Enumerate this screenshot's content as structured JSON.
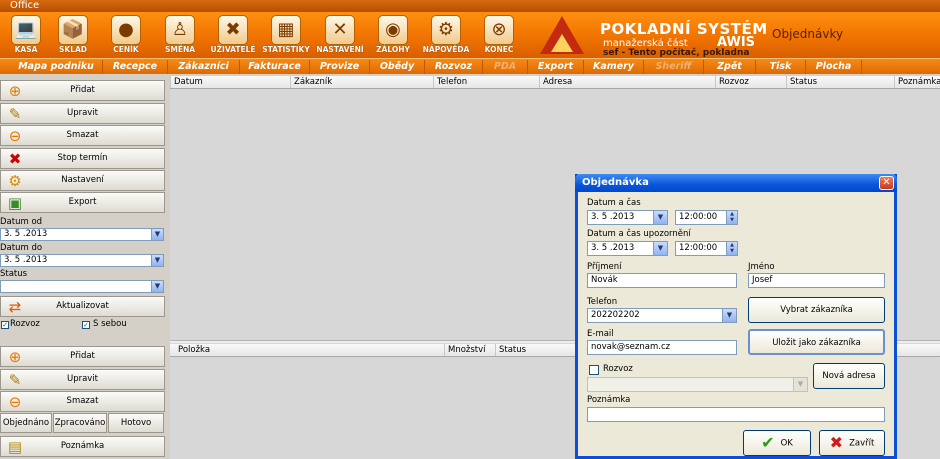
{
  "window": {
    "title": "Office"
  },
  "toolbar": {
    "tools": [
      {
        "label": "KASA",
        "icon": "cash-register-icon",
        "glyph": "💻"
      },
      {
        "label": "SKLAD",
        "icon": "warehouse-icon",
        "glyph": "📦"
      },
      {
        "label": "CENÍK",
        "icon": "price-list-icon",
        "glyph": "●"
      },
      {
        "label": "SMĚNA",
        "icon": "shift-icon",
        "glyph": "♙"
      },
      {
        "label": "UŽIVATELÉ",
        "icon": "users-icon",
        "glyph": "✖"
      },
      {
        "label": "STATISTIKY",
        "icon": "statistics-icon",
        "glyph": "▦"
      },
      {
        "label": "NASTAVENÍ",
        "icon": "settings-tools-icon",
        "glyph": "✕"
      },
      {
        "label": "ZÁLOHY",
        "icon": "backup-disc-icon",
        "glyph": "◉"
      },
      {
        "label": "NÁPOVĚDA",
        "icon": "help-icon",
        "glyph": "⚙"
      },
      {
        "label": "KONEC",
        "icon": "exit-icon",
        "glyph": "⊗"
      }
    ],
    "brand": {
      "title": "POKLADNÍ SYSTÉM",
      "subtitle": "manažerská část",
      "product": "AWIS",
      "section": "Objednávky",
      "user_line": "sef  -  Tento počítač, pokladna"
    }
  },
  "menu": [
    {
      "label": "Mapa podniku",
      "enabled": true
    },
    {
      "label": "Recepce",
      "enabled": true
    },
    {
      "label": "Zákazníci",
      "enabled": true
    },
    {
      "label": "Fakturace",
      "enabled": true
    },
    {
      "label": "Provize",
      "enabled": true
    },
    {
      "label": "Obědy",
      "enabled": true
    },
    {
      "label": "Rozvoz",
      "enabled": true
    },
    {
      "label": "PDA",
      "enabled": false
    },
    {
      "label": "Export",
      "enabled": true
    },
    {
      "label": "Kamery",
      "enabled": true
    },
    {
      "label": "Sheriff",
      "enabled": false
    },
    {
      "label": "Zpět",
      "enabled": true
    },
    {
      "label": "Tisk",
      "enabled": true
    },
    {
      "label": "Plocha",
      "enabled": true
    }
  ],
  "left": {
    "orders_buttons": [
      {
        "label": "Přidat",
        "icon": "add-icon"
      },
      {
        "label": "Upravit",
        "icon": "edit-pencil-icon"
      },
      {
        "label": "Smazat",
        "icon": "remove-icon"
      },
      {
        "label": "Stop termín",
        "icon": "stop-cross-icon"
      },
      {
        "label": "Nastavení",
        "icon": "settings-gear-icon"
      },
      {
        "label": "Export",
        "icon": "export-icon"
      }
    ],
    "date_from_label": "Datum od",
    "date_from_value": "3. 5 .2013",
    "date_to_label": "Datum do",
    "date_to_value": "3. 5 .2013",
    "status_label": "Status",
    "status_value": "",
    "refresh_label": "Aktualizovat",
    "check_delivery_label": "Rozvoz",
    "check_takeaway_label": "S sebou",
    "items_buttons": [
      {
        "label": "Přidat",
        "icon": "add-icon"
      },
      {
        "label": "Upravit",
        "icon": "edit-pencil-icon"
      },
      {
        "label": "Smazat",
        "icon": "remove-icon"
      }
    ],
    "state_buttons": [
      "Objednáno",
      "Zpracováno",
      "Hotovo"
    ],
    "note_label": "Poznámka"
  },
  "orders_grid": {
    "columns": [
      "Datum",
      "Zákazník",
      "Telefon",
      "Adresa",
      "Rozvoz",
      "Status",
      "Poznámka"
    ]
  },
  "items_grid": {
    "columns": [
      "Položka",
      "Množství",
      "Status"
    ]
  },
  "dialog": {
    "title": "Objednávka",
    "datetime_label": "Datum a čas",
    "date_value": "3. 5 .2013",
    "time_value": "12:00:00",
    "reminder_label": "Datum a čas upozornění",
    "reminder_date_value": "3. 5 .2013",
    "reminder_time_value": "12:00:00",
    "surname_label": "Příjmení",
    "surname_value": "Novák",
    "name_label": "Jméno",
    "name_value": "Josef",
    "phone_label": "Telefon",
    "phone_value": "202202202",
    "select_customer_label": "Vybrat zákazníka",
    "email_label": "E-mail",
    "email_value": "novak@seznam.cz",
    "save_customer_label": "Uložit jako zákazníka",
    "delivery_label": "Rozvoz",
    "new_address_label": "Nová adresa",
    "note_label": "Poznámka",
    "note_value": "",
    "ok_label": "OK",
    "close_label": "Zavřít"
  },
  "colors": {
    "toolbar": "#f07300",
    "dialog_title": "#0a56d8",
    "dialog_bg": "#ece9d8"
  }
}
